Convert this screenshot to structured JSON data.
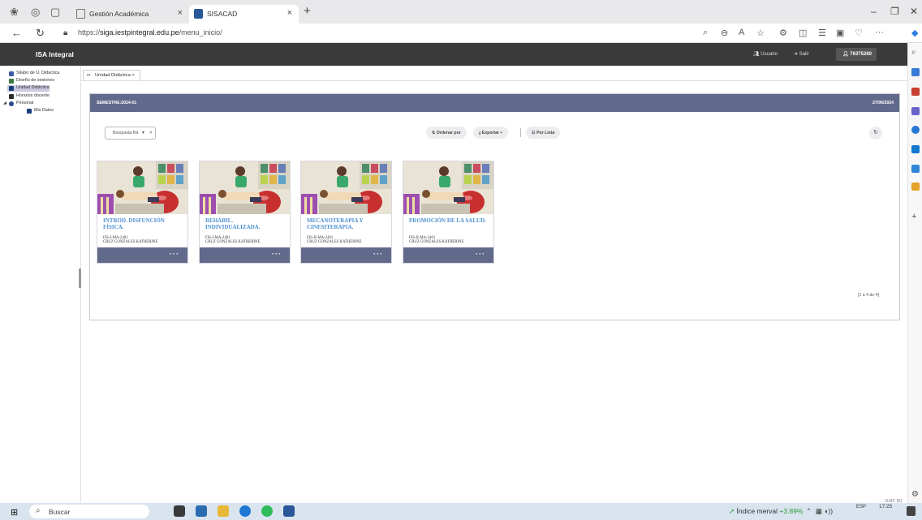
{
  "browser": {
    "tabs": [
      {
        "title": "Gestión Académica",
        "active": false
      },
      {
        "title": "SISACAD",
        "active": true
      }
    ],
    "url_prefix": "https://",
    "url_domain": "siga.iestpintegral.edu.pe",
    "url_path": "/menu_inicio/"
  },
  "app": {
    "brand": "ISA Integral",
    "header_links": {
      "user_label": "Usuario",
      "logout_label": "Salir"
    },
    "user_id": "76375260",
    "sidebar": {
      "items": [
        {
          "label": "Sílabo de U. Didáctica",
          "selected": false
        },
        {
          "label": "Diseño de sesiones",
          "selected": false
        },
        {
          "label": "Unidad Didáctica",
          "selected": true
        },
        {
          "label": "Horarios docente",
          "selected": false
        },
        {
          "label": "Personal",
          "selected": false
        },
        {
          "label": "Mis Datos",
          "selected": false
        }
      ]
    },
    "page_tab": "Unidad Didáctica",
    "panel": {
      "semester": "SEMESTRE:2024-01",
      "date": "27/06/2024",
      "search_placeholder": "Búsqueda Rá",
      "sort_label": "Ordenar por",
      "export_label": "Exportar",
      "list_label": "Por Lista",
      "pager": "[1 a 4 de 4]"
    },
    "courses": [
      {
        "title": "INTROD. DISFUNCIÓN FÍSICA.",
        "code": "FIS-I-MA-2401",
        "teacher": "CRUZ GONZALES KATHERINE"
      },
      {
        "title": "REHABIL. INDIVIDUALIZADA.",
        "code": "FIS-I-MA-2401",
        "teacher": "CRUZ GONZALES KATHERINE"
      },
      {
        "title": "MECANOTERAPIA Y CINESITERAPIA.",
        "code": "FIS-II-MA-2401",
        "teacher": "CRUZ GONZALES KATHERINE"
      },
      {
        "title": "PROMOCIÓN DE LA SALUD.",
        "code": "FIS-II-MA-2401",
        "teacher": "CRUZ GONZALES KATHERINE"
      }
    ],
    "footnote": "JLMC (R)"
  },
  "taskbar": {
    "search_placeholder": "Buscar",
    "market_label": "Índice merval",
    "market_change": "+3.89%",
    "lang": "ESP",
    "time": "17:25"
  },
  "colors": {
    "accent": "#626a8c",
    "link": "#4d8fd1",
    "header": "#3a3a3a",
    "market_up": "#2e9d39"
  }
}
